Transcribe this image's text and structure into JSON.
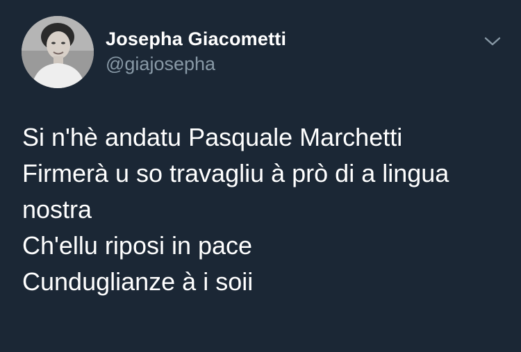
{
  "tweet": {
    "author": {
      "display_name": "Josepha Giacometti",
      "handle": "@giajosepha",
      "avatar_icon": "profile-photo"
    },
    "menu_icon": "chevron-down-icon",
    "text_lines": [
      "Si n'hè andatu Pasquale Marchetti",
      "Firmerà u so travagliu à prò di a lingua",
      "nostra",
      "Ch'ellu riposi in pace",
      "Cunduglianze à i soii"
    ]
  },
  "colors": {
    "background": "#1b2735",
    "name": "#ffffff",
    "handle": "#8899a6",
    "body_text": "#ffffff",
    "chevron": "#8899a6"
  }
}
